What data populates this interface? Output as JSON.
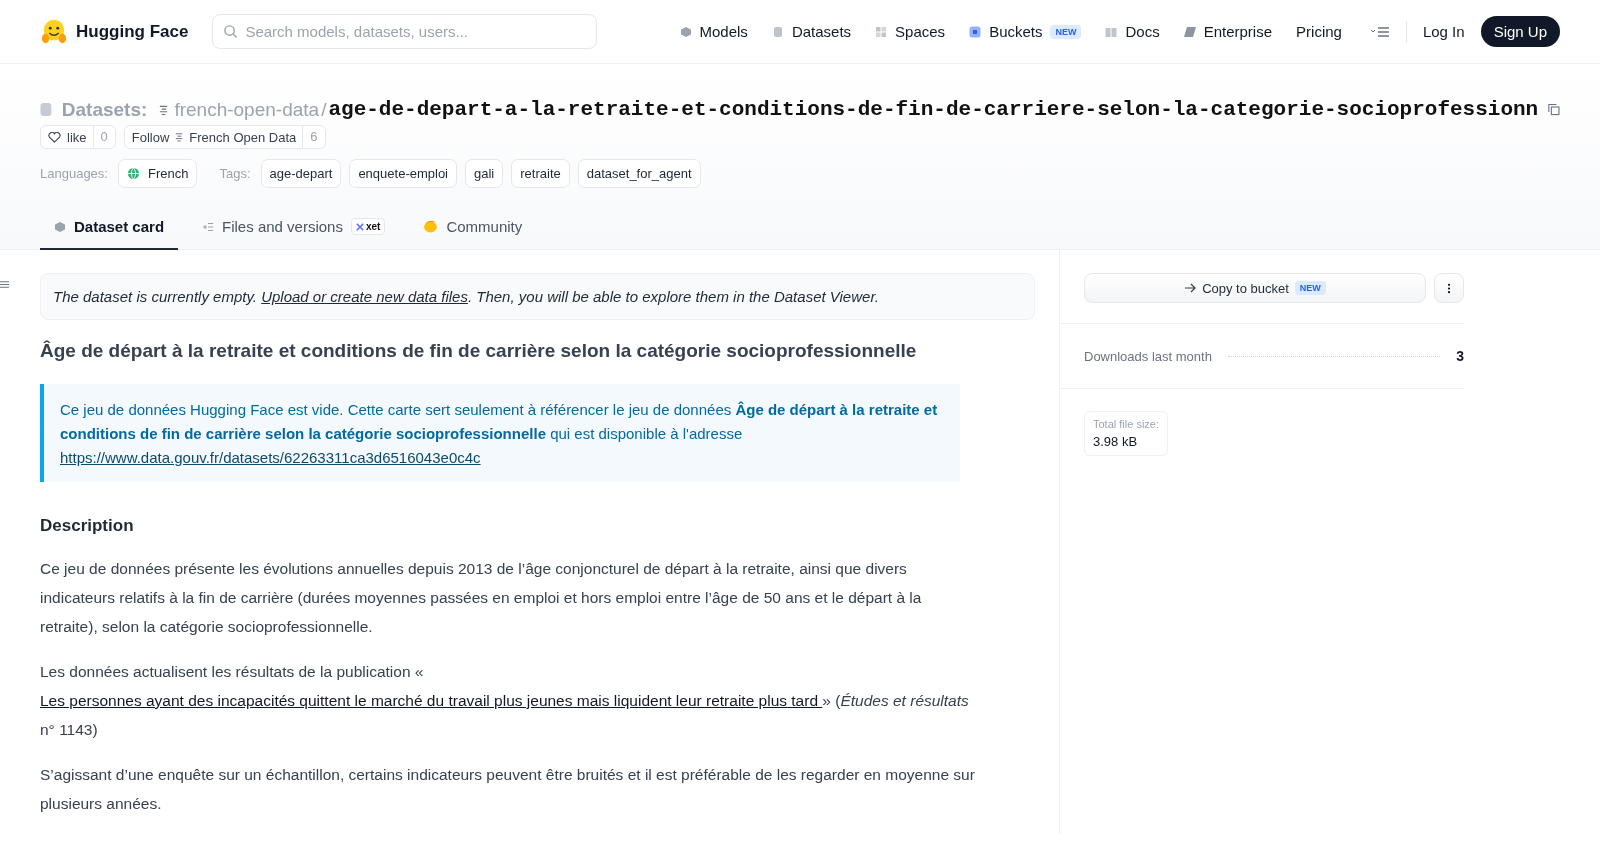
{
  "header": {
    "logo": "Hugging Face",
    "search": {
      "placeholder": "Search models, datasets, users..."
    },
    "nav": [
      {
        "label": "Models"
      },
      {
        "label": "Datasets"
      },
      {
        "label": "Spaces"
      },
      {
        "label": "Buckets",
        "badge": "NEW"
      },
      {
        "label": "Docs"
      },
      {
        "label": "Enterprise"
      },
      {
        "label": "Pricing"
      }
    ],
    "login": "Log In",
    "signup": "Sign Up"
  },
  "repo": {
    "section": "Datasets:",
    "owner": "french-open-data",
    "separator": "/",
    "name": "age-de-depart-a-la-retraite-et-conditions-de-fin-de-carriere-selon-la-categorie-socioprofessionn"
  },
  "like": {
    "label": "like",
    "count": "0"
  },
  "follow": {
    "label": "Follow",
    "org": "French Open Data",
    "count": "6"
  },
  "languages": {
    "label": "Languages:",
    "items": [
      "French"
    ]
  },
  "tags": {
    "label": "Tags:",
    "items": [
      "age-depart",
      "enquete-emploi",
      "gali",
      "retraite",
      "dataset_for_agent"
    ]
  },
  "tabs": [
    {
      "label": "Dataset card",
      "selected": true
    },
    {
      "label": "Files and versions",
      "selected": false,
      "badge": "xet"
    },
    {
      "label": "Community",
      "selected": false
    }
  ],
  "notice": [
    {
      "kind": "text",
      "text": "The dataset is currently empty. "
    },
    {
      "kind": "link",
      "text": "Upload or create new data files"
    },
    {
      "kind": "text",
      "text": ". Then, you will be able to explore them in the Dataset Viewer."
    }
  ],
  "title": "Âge de départ à la retraite et conditions de fin de carrière selon la catégorie socioprofessionnelle",
  "callout": {
    "text": "Ce jeu de données Hugging Face est vide. Cette carte sert seulement à référencer le jeu de données **Âge de départ à la retraite et conditions de fin de carrière selon la catégorie socioprofessionnelle** qui est disponible à l'adresse",
    "link": "https://www.data.gouv.fr/datasets/62263311ca3d6516043e0c4c"
  },
  "description": {
    "heading": "Description",
    "paragraphs": [
      [
        {
          "kind": "text",
          "text": "Ce jeu de données présente les évolutions annuelles depuis 2013 de l’âge conjoncturel de départ à la retraite, ainsi que divers indicateurs relatifs à la fin de carrière (durées moyennes passées en emploi et hors emploi entre l’âge de 50 ans et le départ à la retraite), selon la catégorie socioprofessionnelle."
        }
      ],
      [
        {
          "kind": "text",
          "text": "Les données actualisent les résultats de la publication « "
        },
        {
          "kind": "link",
          "text": "Les personnes ayant des incapacités quittent le marché du travail plus jeunes mais liquident leur retraite plus tard "
        },
        {
          "kind": "text",
          "text": "» (*Études et résultats* n° 1143)"
        }
      ],
      [
        {
          "kind": "text",
          "text": "S’agissant d’une enquête sur un échantillon, certains indicateurs peuvent être bruités et il est préférable de les regarder en moyenne sur plusieurs années."
        }
      ]
    ]
  },
  "sidebar": {
    "copy_button": {
      "label": "Copy to bucket",
      "badge": "NEW"
    },
    "downloads": {
      "label": "Downloads last month",
      "value": "3"
    },
    "file_size": {
      "label": "Total file size:",
      "value": "3.98 kB"
    }
  }
}
